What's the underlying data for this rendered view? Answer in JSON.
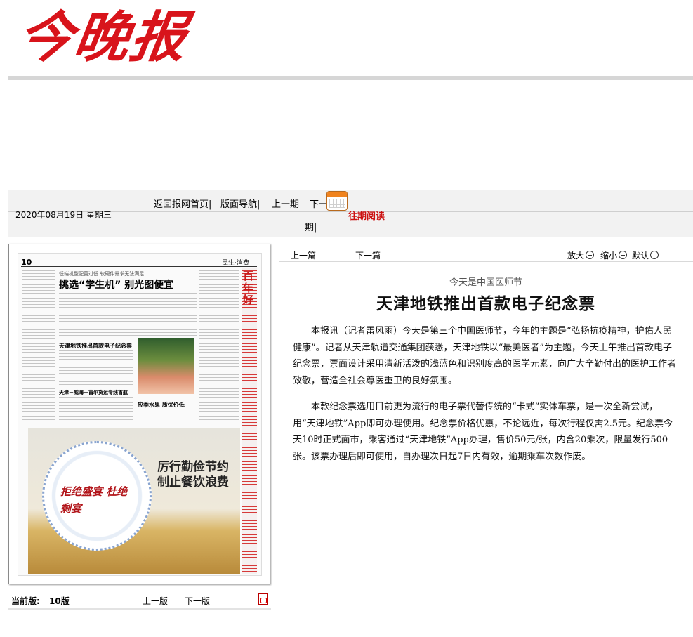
{
  "masthead": {
    "logo_text": "今晚报"
  },
  "nav": {
    "date": "2020年08月19日  星期三",
    "home": "返回报网首页",
    "layout": "版面导航",
    "prev_issue": "上一期",
    "next_issue_a": "下一",
    "next_issue_b": "期",
    "past_reading": "往期阅读"
  },
  "thumbnail": {
    "page_num": "10",
    "section": "民生·消费",
    "headline_small": "低端机型配置过低  软硬件需求无法满足",
    "headline": "挑选“学生机”  别光图便宜",
    "sub_a": "天津地铁推出首款电子纪念票",
    "sub_b": "天津－威海－首尔货运专线首航",
    "sub_c": "应季水果  质优价低",
    "side_title": "百年好",
    "ad_line1": "厉行勤俭节约",
    "ad_line2": "制止餐饮浪费",
    "ad_seal": "拒绝盛宴 杜绝剩宴"
  },
  "page_nav": {
    "current_label": "当前版:",
    "current_value": "10版",
    "prev": "上一版",
    "next": "下一版"
  },
  "article": {
    "toolbar": {
      "prev": "上一篇",
      "next": "下一篇",
      "zoom_in": "放大",
      "zoom_out": "缩小",
      "reset": "默认"
    },
    "subhead": "今天是中国医师节",
    "headline": "天津地铁推出首款电子纪念票",
    "paragraphs": [
      "本报讯（记者雷风雨）今天是第三个中国医师节，今年的主题是“弘扬抗疫精神，护佑人民健康”。记者从天津轨道交通集团获悉，天津地铁以“最美医者”为主题，今天上午推出首款电子纪念票，票面设计采用清新活泼的浅蓝色和识别度高的医学元素，向广大辛勤付出的医护工作者致敬，营造全社会尊医重卫的良好氛围。",
      "本款纪念票选用目前更为流行的电子票代替传统的“卡式”实体车票，是一次全新尝试，用“天津地铁”App即可办理使用。纪念票价格优惠，不论远近，每次行程仅需2.5元。纪念票今天10时正式面市，乘客通过“天津地铁”App办理，售价50元/张，内含20乘次，限量发行500张。该票办理后即可使用，自办理次日起7日内有效，逾期乘车次数作废。"
    ]
  }
}
